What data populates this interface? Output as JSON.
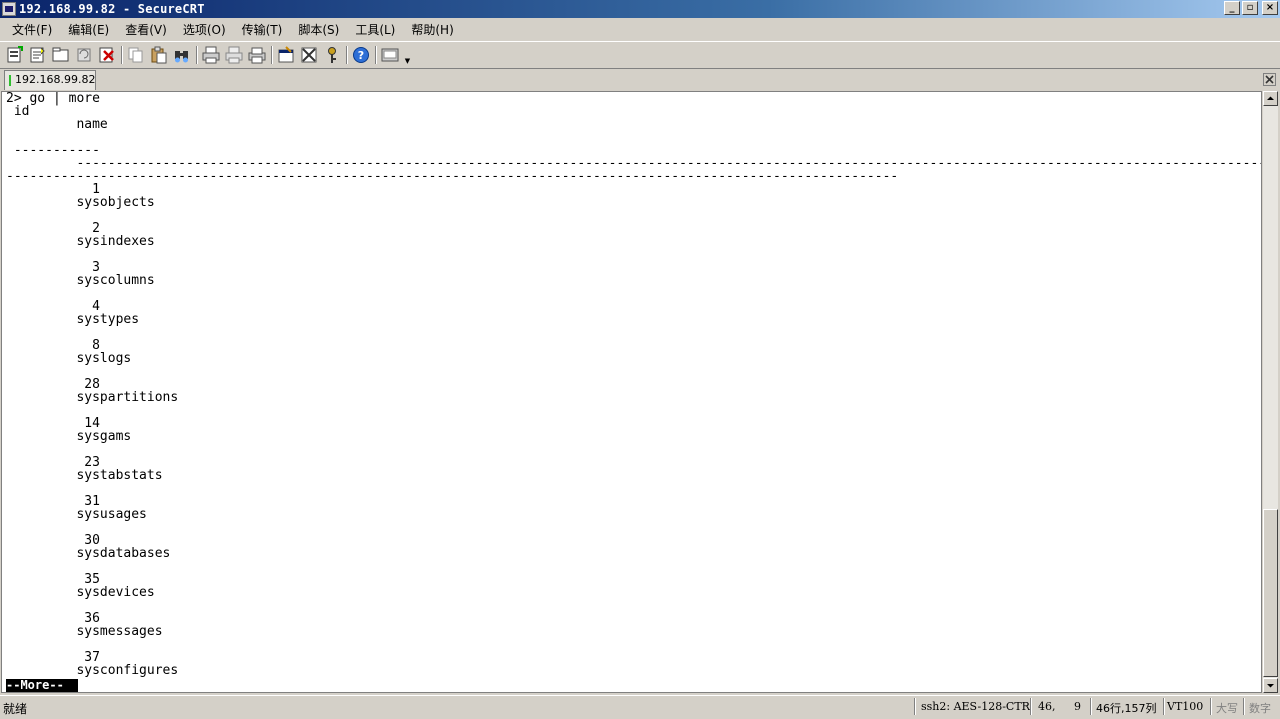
{
  "window": {
    "title": "192.168.99.82 - SecureCRT"
  },
  "menu": [
    "文件(F)",
    "编辑(E)",
    "查看(V)",
    "选项(O)",
    "传输(T)",
    "脚本(S)",
    "工具(L)",
    "帮助(H)"
  ],
  "toolbar_icons": [
    "connect-icon",
    "quick-connect-icon",
    "connect-in-tab-icon",
    "reconnect-icon",
    "disconnect-icon",
    "copy-icon",
    "paste-icon",
    "find-icon",
    "print-icon",
    "print-setup-icon",
    "print-selection-icon",
    "session-options-icon",
    "global-options-icon",
    "keymap-icon",
    "help-icon",
    "keyboard-icon"
  ],
  "tab": {
    "label": "192.168.99.82"
  },
  "terminal": {
    "text": "2> go | more\n id\n         name\n\n -----------\n         ------------------------------------------------------------------------------------------------------------------------------------------------------------\n------------------------------------------------------------------------------------------------------------------\n           1\n         sysobjects\n\n           2\n         sysindexes\n\n           3\n         syscolumns\n\n           4\n         systypes\n\n           8\n         syslogs\n\n          28\n         syspartitions\n\n          14\n         sysgams\n\n          23\n         systabstats\n\n          31\n         sysusages\n\n          30\n         sysdatabases\n\n          35\n         sysdevices\n\n          36\n         sysmessages\n\n          37\n         sysconfigures",
    "pager_prompt": "--More--"
  },
  "statusbar": {
    "ready": "就绪",
    "protocol": "ssh2: AES-128-CTR",
    "row": "46,",
    "col": "9",
    "size": "46行,157列",
    "terminal_type": "VT100",
    "caps": "大写",
    "num": "数字"
  }
}
